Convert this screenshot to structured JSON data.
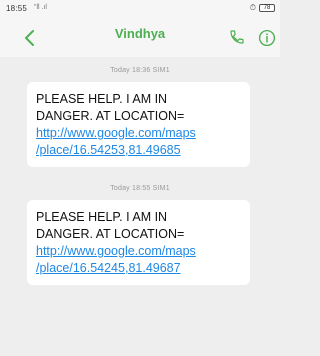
{
  "status_bar": {
    "time": "18:55",
    "signal_text": "\"ll .ıl ",
    "battery": "78"
  },
  "header": {
    "contact_name": "Vindhya",
    "icons": [
      "back-arrow-icon",
      "phone-icon",
      "info-icon"
    ]
  },
  "messages": [
    {
      "timestamp": "Today 18:36 SIM1",
      "lines": [
        "PLEASE HELP. I AM IN",
        "DANGER. AT LOCATION="
      ],
      "link_lines": [
        "http://www.google.com/maps",
        "/place/16.54253,81.49685"
      ]
    },
    {
      "timestamp": "Today 18:55 SIM1",
      "lines": [
        "PLEASE HELP. I AM IN",
        "DANGER. AT LOCATION="
      ],
      "link_lines": [
        "http://www.google.com/maps",
        "/place/16.54245,81.49687"
      ]
    }
  ],
  "colors": {
    "accent": "#4caf50",
    "link": "#1e88e5",
    "background": "#eeeeee",
    "bubble": "#ffffff"
  }
}
